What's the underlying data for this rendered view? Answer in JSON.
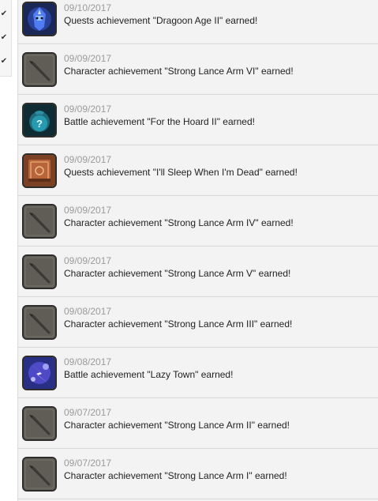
{
  "left_checks": [
    "✔",
    "✔",
    "✔"
  ],
  "feed": [
    {
      "date": "09/10/2017",
      "text": "Quests achievement \"Dragoon Age II\" earned!",
      "icon": "dragoon-icon"
    },
    {
      "date": "09/09/2017",
      "text": "Character achievement \"Strong Lance Arm VI\" earned!",
      "icon": "lance-icon"
    },
    {
      "date": "09/09/2017",
      "text": "Battle achievement \"For the Hoard II\" earned!",
      "icon": "treasure-sack-icon"
    },
    {
      "date": "09/09/2017",
      "text": "Quests achievement \"I'll Sleep When I'm Dead\" earned!",
      "icon": "tome-icon"
    },
    {
      "date": "09/09/2017",
      "text": "Character achievement \"Strong Lance Arm IV\" earned!",
      "icon": "lance-icon"
    },
    {
      "date": "09/09/2017",
      "text": "Character achievement \"Strong Lance Arm V\" earned!",
      "icon": "lance-icon"
    },
    {
      "date": "09/08/2017",
      "text": "Character achievement \"Strong Lance Arm III\" earned!",
      "icon": "lance-icon"
    },
    {
      "date": "09/08/2017",
      "text": "Battle achievement \"Lazy Town\" earned!",
      "icon": "lightning-icon"
    },
    {
      "date": "09/07/2017",
      "text": "Character achievement \"Strong Lance Arm II\" earned!",
      "icon": "lance-icon"
    },
    {
      "date": "09/07/2017",
      "text": "Character achievement \"Strong Lance Arm I\" earned!",
      "icon": "lance-icon"
    }
  ]
}
